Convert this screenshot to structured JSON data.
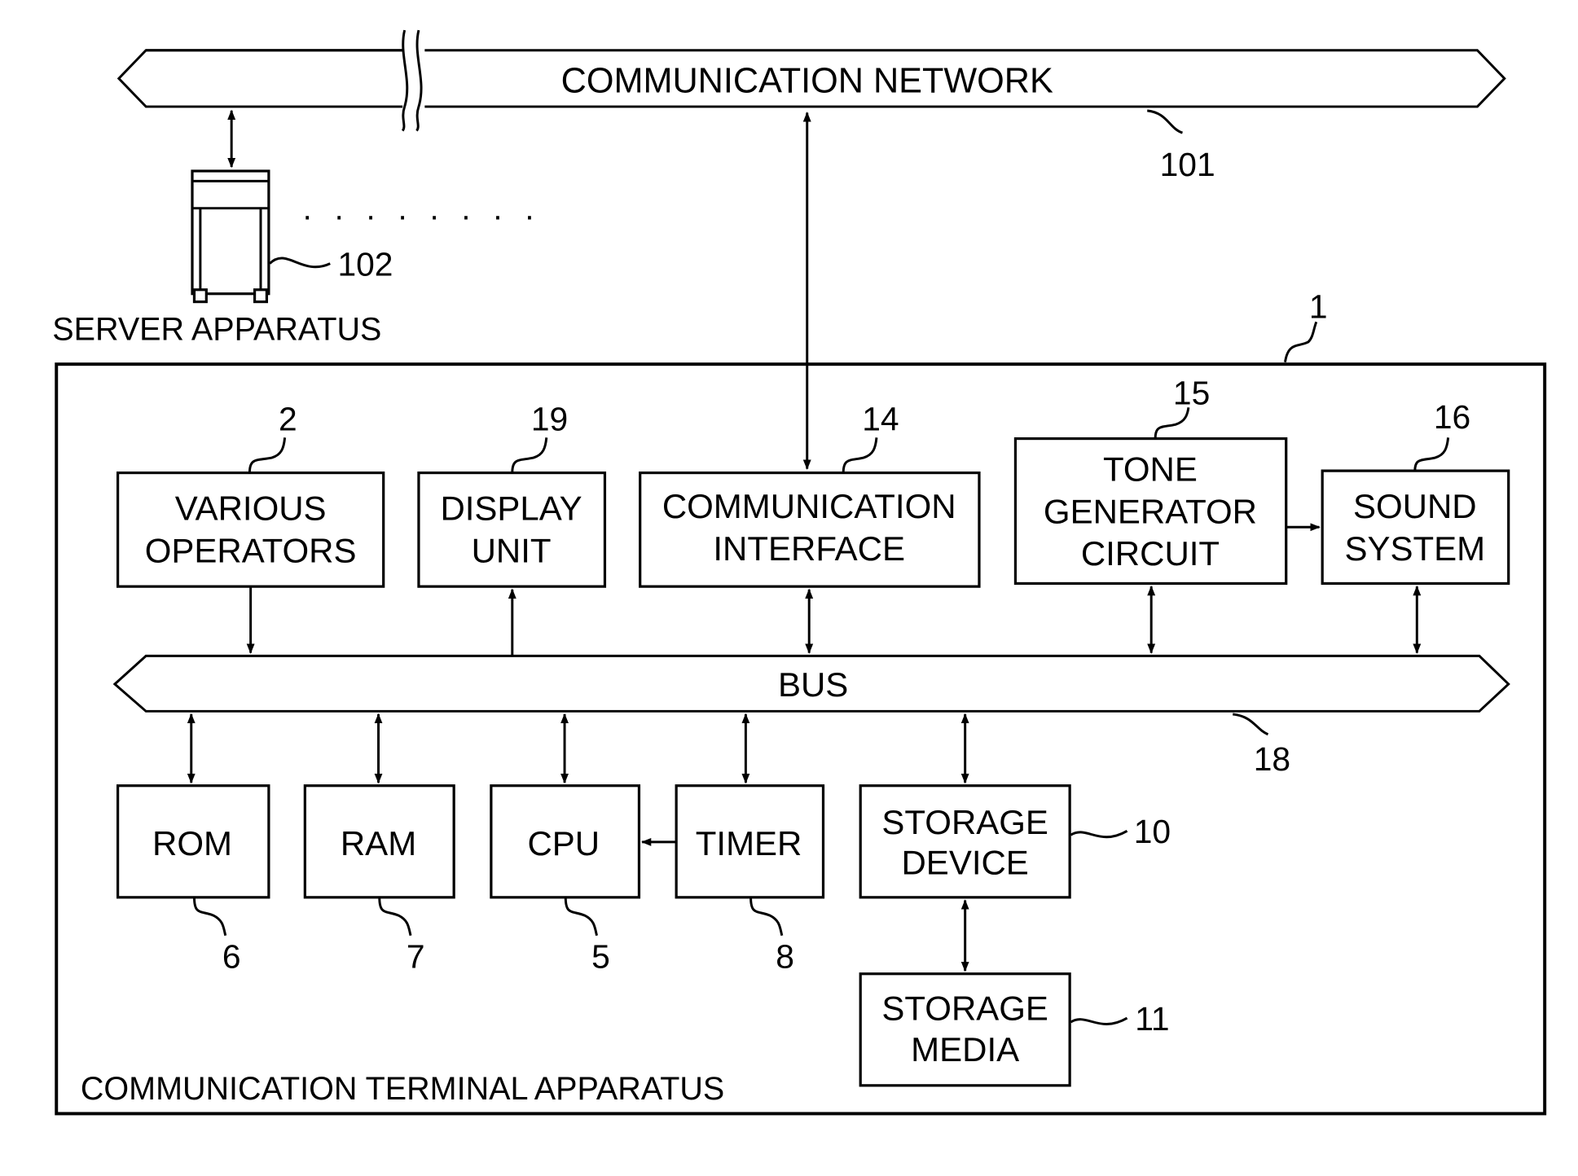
{
  "network": {
    "label": "COMMUNICATION NETWORK",
    "ref": "101"
  },
  "server": {
    "label": "SERVER APPARATUS",
    "ref": "102",
    "ellipsis": "· · · · · · · ·"
  },
  "terminal": {
    "label": "COMMUNICATION TERMINAL APPARATUS",
    "ref": "1"
  },
  "bus": {
    "label": "BUS",
    "ref": "18"
  },
  "blocks": {
    "various_operators": {
      "lines": [
        "VARIOUS",
        "OPERATORS"
      ],
      "ref": "2"
    },
    "display_unit": {
      "lines": [
        "DISPLAY",
        "UNIT"
      ],
      "ref": "19"
    },
    "communication_interface": {
      "lines": [
        "COMMUNICATION",
        "INTERFACE"
      ],
      "ref": "14"
    },
    "tone_generator": {
      "lines": [
        "TONE",
        "GENERATOR",
        "CIRCUIT"
      ],
      "ref": "15"
    },
    "sound_system": {
      "lines": [
        "SOUND",
        "SYSTEM"
      ],
      "ref": "16"
    },
    "rom": {
      "lines": [
        "ROM"
      ],
      "ref": "6"
    },
    "ram": {
      "lines": [
        "RAM"
      ],
      "ref": "7"
    },
    "cpu": {
      "lines": [
        "CPU"
      ],
      "ref": "5"
    },
    "timer": {
      "lines": [
        "TIMER"
      ],
      "ref": "8"
    },
    "storage_device": {
      "lines": [
        "STORAGE",
        "DEVICE"
      ],
      "ref": "10"
    },
    "storage_media": {
      "lines": [
        "STORAGE",
        "MEDIA"
      ],
      "ref": "11"
    }
  }
}
